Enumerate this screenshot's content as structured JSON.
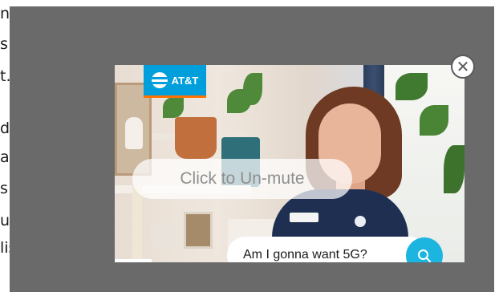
{
  "background_page": {
    "lines": [
      "nd",
      "s ",
      "t.",
      "d",
      "ay",
      "s ",
      "u",
      "lis"
    ]
  },
  "ad": {
    "brand_label": "AT&T",
    "unmute_label": "Click to Un-mute",
    "question_label": "Am I gonna want 5G?",
    "close_symbol": "✕",
    "accent_color": "#009fdb",
    "search_color": "#1bb5e0"
  }
}
